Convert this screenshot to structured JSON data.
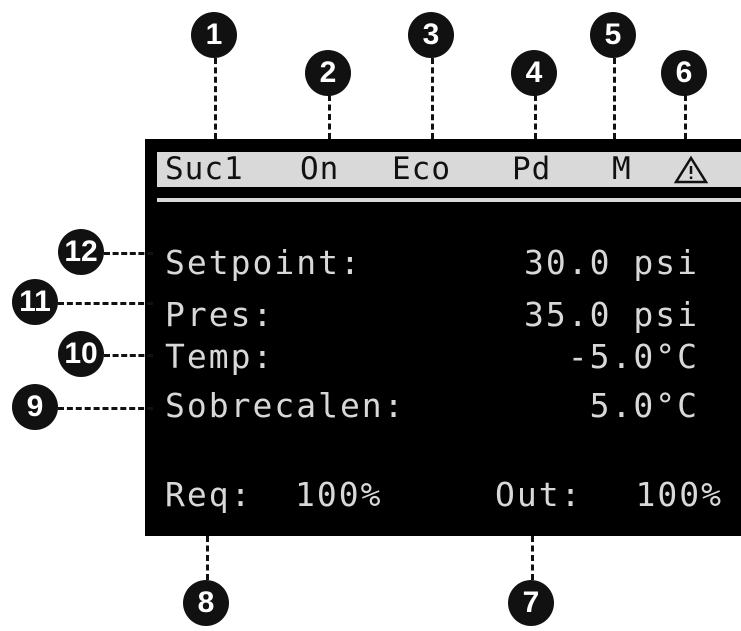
{
  "status_bar": {
    "circuit": "Suc1",
    "state": "On",
    "mode": "Eco",
    "pumpdown": "Pd",
    "manual": "M",
    "alarm_icon": "warning-triangle-icon"
  },
  "rows": {
    "setpoint_label": "Setpoint:",
    "setpoint_value": "30.0 psi",
    "pressure_label": "Pres:",
    "pressure_value": "35.0 psi",
    "temp_label": "Temp:",
    "temp_value": "-5.0°C",
    "superheat_label": "Sobrecalen:",
    "superheat_value": "5.0°C",
    "req_label": "Req:",
    "req_value": "100%",
    "out_label": "Out:",
    "out_value": "100%"
  },
  "callouts": [
    "1",
    "2",
    "3",
    "4",
    "5",
    "6",
    "7",
    "8",
    "9",
    "10",
    "11",
    "12"
  ],
  "colors": {
    "screen_bg": "#000000",
    "status_bar_bg": "#d9d9d9",
    "lcd_text": "#d8d8d8",
    "badge_bg": "#111111"
  }
}
